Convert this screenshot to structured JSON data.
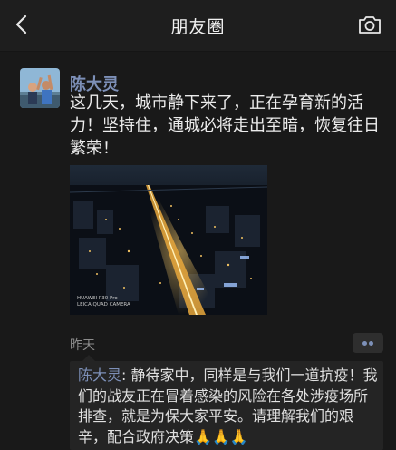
{
  "header": {
    "title": "朋友圈",
    "back_icon": "chevron-left-icon",
    "camera_icon": "camera-icon"
  },
  "post": {
    "author": "陈大灵",
    "text": "这几天，城市静下来了，正在孕育新的活力！坚持住，通城必将走出至暗，恢复往日繁荣！",
    "photo_caption_line1": "HUAWEI P30 Pro",
    "photo_caption_line2": "LEICA QUAD CAMERA",
    "time": "昨天",
    "more_icon": "more-dots-icon"
  },
  "comment": {
    "author": "陈大灵",
    "separator": ": ",
    "text": "静待家中，同样是与我们一道抗疫！我们的战友正在冒着感染的风险在各处涉疫场所排查，就是为保大家平安。请理解我们的艰辛，配合政府决策",
    "emoji": "🙏🙏🙏"
  },
  "colors": {
    "background": "#191919",
    "name_link": "#7d90b8",
    "text": "#ececec"
  }
}
